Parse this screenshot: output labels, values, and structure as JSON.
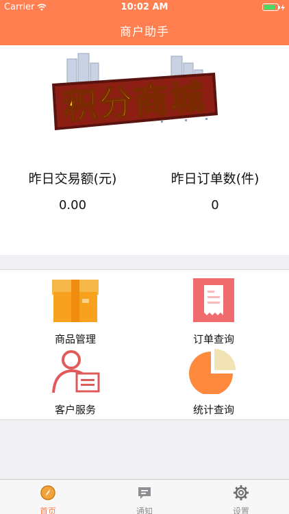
{
  "status_bar": {
    "carrier": "Carrier",
    "time": "10:02 AM",
    "battery_percent": 80
  },
  "nav": {
    "title": "商户助手"
  },
  "banner": {
    "logo_text": "积分商城"
  },
  "stats": {
    "yesterday_amount_label": "昨日交易额(元)",
    "yesterday_amount_value": "0.00",
    "yesterday_orders_label": "昨日订单数(件)",
    "yesterday_orders_value": "0"
  },
  "menu": {
    "product_mgmt": "商品管理",
    "order_query": "订单查询",
    "customer_service": "客户服务",
    "stats_query": "统计查询"
  },
  "tabbar": {
    "home": "首页",
    "notice": "通知",
    "settings": "设置"
  },
  "colors": {
    "brand": "#ff7f50",
    "box": "#f7a11f",
    "receipt": "#f06b6b",
    "customer": "#e05a5a",
    "pie": "#ff8a3d"
  },
  "icons": {
    "tile1": "product-box-icon",
    "tile2": "order-receipt-icon",
    "tile3": "customer-service-icon",
    "tile4": "pie-chart-icon",
    "tab1": "home-compass-icon",
    "tab2": "notice-chat-icon",
    "tab3": "settings-gear-icon"
  }
}
